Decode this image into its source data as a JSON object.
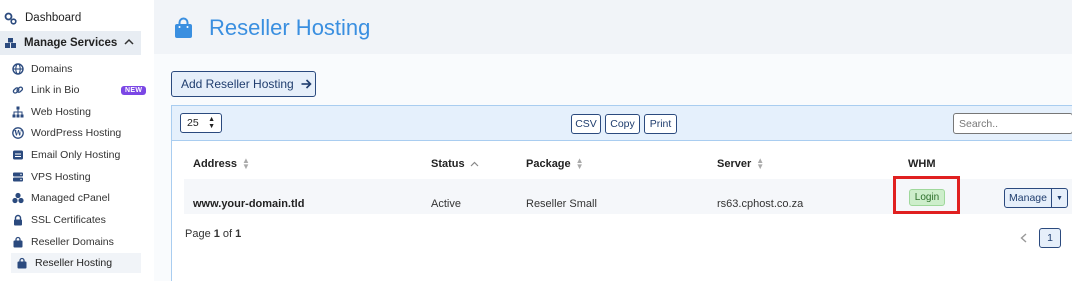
{
  "sidebar": {
    "dashboard": "Dashboard",
    "group": "Manage Services",
    "items": [
      {
        "label": "Domains",
        "icon": "globe-icon"
      },
      {
        "label": "Link in Bio",
        "icon": "link-icon",
        "badge": "NEW"
      },
      {
        "label": "Web Hosting",
        "icon": "sitemap-icon"
      },
      {
        "label": "WordPress Hosting",
        "icon": "wordpress-icon"
      },
      {
        "label": "Email Only Hosting",
        "icon": "envelope-icon"
      },
      {
        "label": "VPS Hosting",
        "icon": "server-icon"
      },
      {
        "label": "Managed cPanel",
        "icon": "cubes-icon"
      },
      {
        "label": "SSL Certificates",
        "icon": "lock-icon"
      },
      {
        "label": "Reseller Domains",
        "icon": "bag-icon"
      },
      {
        "label": "Reseller Hosting",
        "icon": "bag-icon"
      }
    ]
  },
  "header": {
    "title": "Reseller Hosting"
  },
  "actions": {
    "add": "Add Reseller Hosting"
  },
  "table": {
    "page_length": "25",
    "export": {
      "csv": "CSV",
      "copy": "Copy",
      "print": "Print"
    },
    "search_placeholder": "Search..",
    "columns": {
      "address": "Address",
      "status": "Status",
      "package": "Package",
      "server": "Server",
      "whm": "WHM"
    },
    "rows": [
      {
        "address": "www.your-domain.tld",
        "status": "Active",
        "package": "Reseller Small",
        "server": "rs63.cphost.co.za",
        "whm": "Login",
        "manage": "Manage"
      }
    ],
    "page_info": {
      "prefix": "Page ",
      "current": "1",
      "of": " of ",
      "total": "1"
    },
    "pagination_current": "1"
  },
  "colors": {
    "accent": "#3a8fe0",
    "primary": "#2b4a7e",
    "highlight": "#e02020",
    "success_bg": "#cdeecb"
  }
}
